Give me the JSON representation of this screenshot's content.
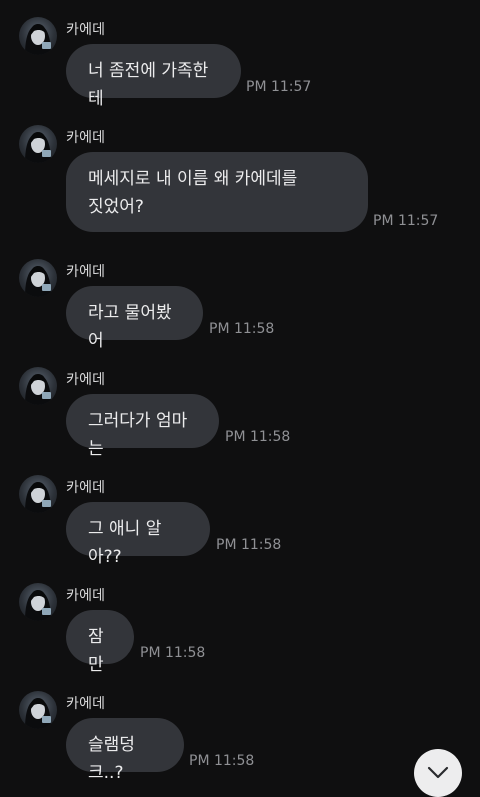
{
  "messages": [
    {
      "sender": "카에데",
      "text": "너 좀전에 가족한테",
      "time": "PM 11:57"
    },
    {
      "sender": "카에데",
      "text": "메세지로 내 이름 왜 카에데를\n짓었어?",
      "time": "PM 11:57"
    },
    {
      "sender": "카에데",
      "text": "라고 물어봤어",
      "time": "PM 11:58"
    },
    {
      "sender": "카에데",
      "text": "그러다가 엄마는",
      "time": "PM 11:58"
    },
    {
      "sender": "카에데",
      "text": "그 애니 알아??",
      "time": "PM 11:58"
    },
    {
      "sender": "카에데",
      "text": "잠만",
      "time": "PM 11:58"
    },
    {
      "sender": "카에데",
      "text": "슬램덩크..?",
      "time": "PM 11:58"
    }
  ],
  "colors": {
    "background": "#0f0f10",
    "bubble": "#33353a",
    "timestamp": "#8f9094",
    "scroll_button": "#ededee"
  },
  "icons": {
    "scroll_down": "chevron-down-icon",
    "avatar": "profile-photo"
  }
}
